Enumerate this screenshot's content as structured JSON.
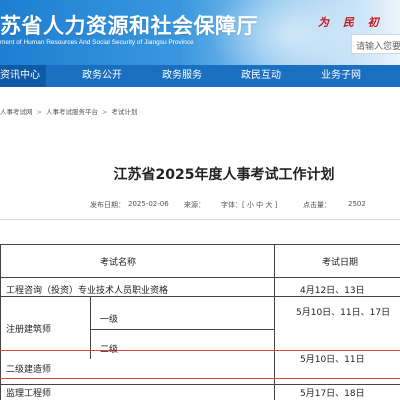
{
  "header": {
    "site_title": "苏省人力资源和社会保障厅",
    "site_subtitle": "ment of Human Resources And Social Security of Jiangsu Province",
    "calligraphy": "为 民 初",
    "search_placeholder": "请输入您要"
  },
  "nav": {
    "items": [
      {
        "label": "资讯中心",
        "active": true
      },
      {
        "label": "政务公开"
      },
      {
        "label": "政务服务"
      },
      {
        "label": "政民互动"
      },
      {
        "label": "业务子网"
      }
    ]
  },
  "breadcrumb": [
    "人事考试网",
    "人事考试服务平台",
    "考试计划"
  ],
  "article": {
    "title": "江苏省2025年度人事考试工作计划",
    "publish_label": "发布日期：",
    "publish_date": "2025-02-06",
    "source_label": "来源：",
    "font_label": "字体：[ 小 中 大 ]",
    "hits_label": "点击量：",
    "hits": "2502"
  },
  "table": {
    "headers": [
      "考试名称",
      "考试日期"
    ],
    "rows": [
      {
        "name": "工程咨询（投资）专业技术人员职业资格",
        "date": "4月12日、13日"
      },
      {
        "name": "注册建筑师",
        "sub": "一级",
        "date": "5月10日、11日、17日"
      },
      {
        "name": "",
        "sub": "二级",
        "date": ""
      },
      {
        "name": "二级建造师",
        "date": "5月10日、11日"
      },
      {
        "name": "监理工程师",
        "date": "5月17日、18日"
      }
    ]
  },
  "colors": {
    "header_blue": "#1d7fd1",
    "nav_blue": "#1a6fc0",
    "nav_active": "#0e5aa6",
    "calligraphy_red": "#c8161d",
    "annotation_red": "#d9463c"
  }
}
